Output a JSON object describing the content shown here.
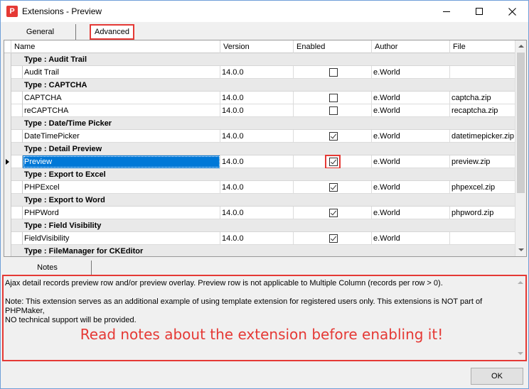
{
  "window": {
    "title": "Extensions - Preview",
    "app_icon_letter": "P"
  },
  "tabs": [
    {
      "label": "General"
    },
    {
      "label": "Advanced"
    }
  ],
  "grid": {
    "columns": [
      "Name",
      "Version",
      "Enabled",
      "Author",
      "File"
    ],
    "rows": [
      {
        "kind": "group",
        "label": "Type : Audit Trail"
      },
      {
        "kind": "item",
        "name": "Audit Trail",
        "version": "14.0.0",
        "enabled": false,
        "author": "e.World",
        "file": ""
      },
      {
        "kind": "group",
        "label": "Type : CAPTCHA"
      },
      {
        "kind": "item",
        "name": "CAPTCHA",
        "version": "14.0.0",
        "enabled": false,
        "author": "e.World",
        "file": "captcha.zip"
      },
      {
        "kind": "item",
        "name": "reCAPTCHA",
        "version": "14.0.0",
        "enabled": false,
        "author": "e.World",
        "file": "recaptcha.zip"
      },
      {
        "kind": "group",
        "label": "Type : Date/Time Picker"
      },
      {
        "kind": "item",
        "name": "DateTimePicker",
        "version": "14.0.0",
        "enabled": true,
        "author": "e.World",
        "file": "datetimepicker.zip"
      },
      {
        "kind": "group",
        "label": "Type : Detail Preview"
      },
      {
        "kind": "item",
        "name": "Preview",
        "version": "14.0.0",
        "enabled": true,
        "author": "e.World",
        "file": "preview.zip",
        "selected": true,
        "highlight_check": true
      },
      {
        "kind": "group",
        "label": "Type : Export to Excel"
      },
      {
        "kind": "item",
        "name": "PHPExcel",
        "version": "14.0.0",
        "enabled": true,
        "author": "e.World",
        "file": "phpexcel.zip"
      },
      {
        "kind": "group",
        "label": "Type : Export to Word"
      },
      {
        "kind": "item",
        "name": "PHPWord",
        "version": "14.0.0",
        "enabled": true,
        "author": "e.World",
        "file": "phpword.zip"
      },
      {
        "kind": "group",
        "label": "Type : Field Visibility"
      },
      {
        "kind": "item",
        "name": "FieldVisibility",
        "version": "14.0.0",
        "enabled": true,
        "author": "e.World",
        "file": ""
      },
      {
        "kind": "group",
        "label": "Type : FileManager for CKEditor"
      }
    ]
  },
  "notes": {
    "tab_label": "Notes",
    "paragraphs": [
      "Ajax detail records preview row and/or preview overlay. Preview row is not applicable to Multiple Column (records per row > 0).",
      "Note: This extension serves as an additional example of using template extension for registered users only. This extensions is NOT part of PHPMaker,\nNO technical support will be provided."
    ],
    "callout": "Read notes about the extension before enabling it!"
  },
  "footer": {
    "ok_label": "OK"
  },
  "colors": {
    "highlight": "#e53935",
    "selection": "#0078d7"
  }
}
